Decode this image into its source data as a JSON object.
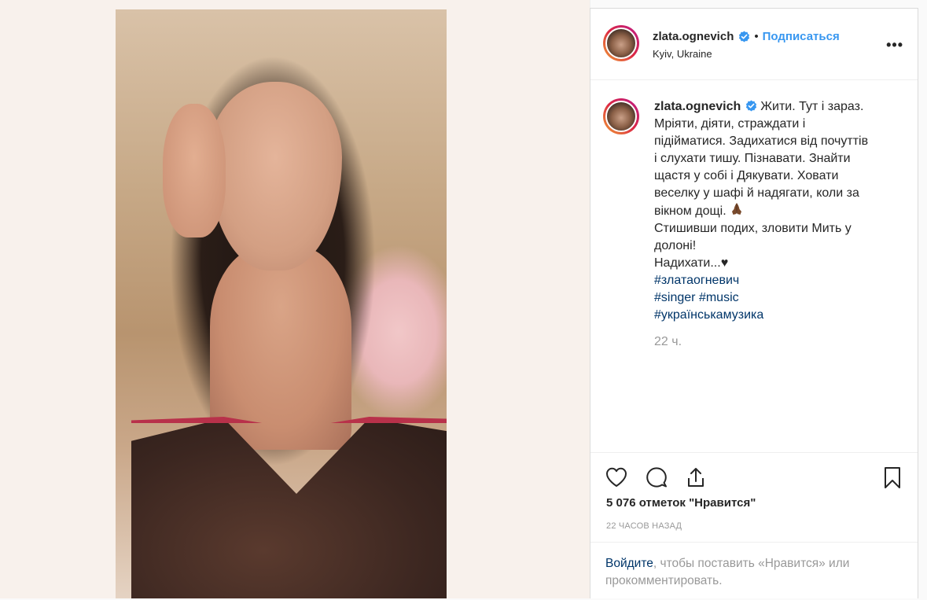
{
  "post": {
    "author": {
      "username": "zlata.ognevich",
      "verified": true,
      "location": "Kyiv, Ukraine"
    },
    "header": {
      "separator": "•",
      "follow_label": "Подписаться",
      "more_icon": "more-options-icon",
      "more_label": "•••"
    },
    "caption": {
      "lines": [
        "Жити. Тут і зараз.",
        "Мріяти, діяти, страждати і",
        "підійматися. Задихатися від почуттів",
        "і слухати тишу. Пізнавати. Знайти",
        "щастя у собі і Дякувати. Ховати",
        "веселку у шафі й надягати, коли за",
        "вікном дощі.",
        "Стишивши подих, зловити Мить у",
        "долоні!",
        "Надихати...♥"
      ],
      "hashtags": [
        "#златаогневич",
        "#singer",
        "#music",
        "#українськамузика"
      ],
      "time_ago": "22 ч."
    },
    "actions": {
      "icons": [
        "heart-icon",
        "comment-icon",
        "share-icon",
        "bookmark-icon"
      ]
    },
    "likes_text": "5 076 отметок \"Нравится\"",
    "posted_text": "22 часов назад",
    "login_prompt": {
      "link": "Войдите",
      "text": ", чтобы поставить «Нравится» или прокомментировать."
    },
    "colors": {
      "follow": "#3897f0",
      "hashtag": "#003569",
      "muted": "#999999",
      "verified": "#3897f0"
    }
  }
}
